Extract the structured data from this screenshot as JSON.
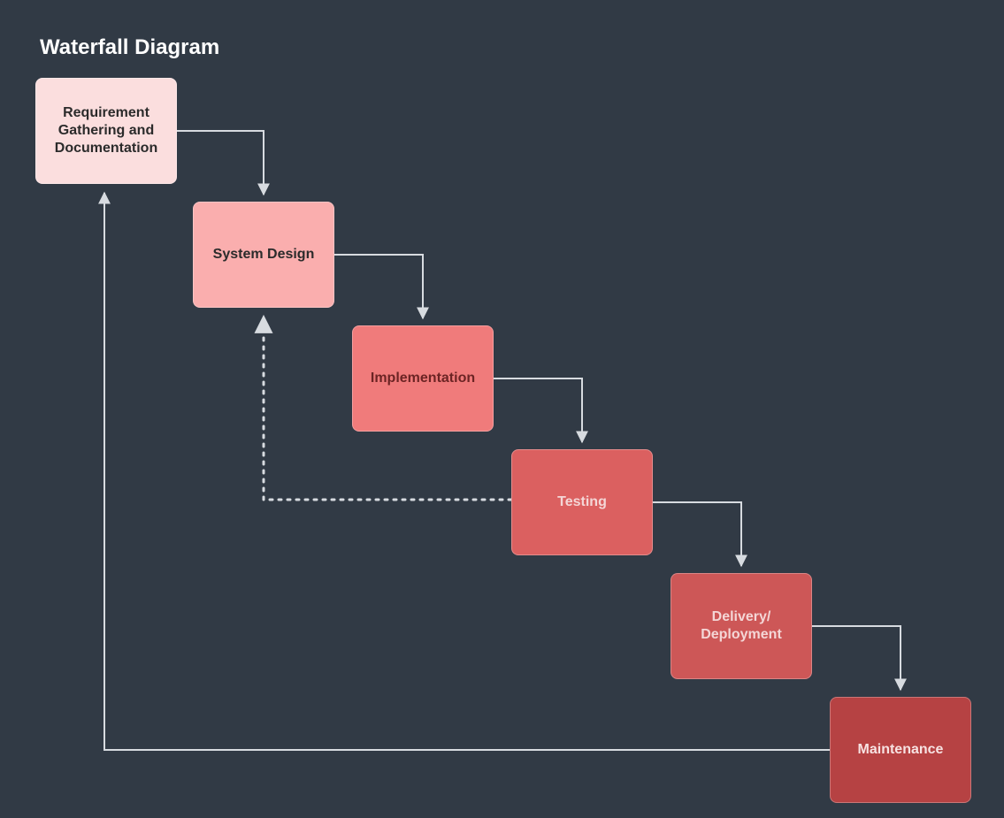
{
  "title": "Waterfall Diagram",
  "nodes": {
    "n1": "Requirement Gathering and Documentation",
    "n2": "System Design",
    "n3": "Implementation",
    "n4": "Testing",
    "n5": "Delivery/ Deployment",
    "n6": "Maintenance"
  },
  "colors": {
    "background": "#313a45",
    "line": "#d7dbe0",
    "dotted": "#d7dbe0",
    "nodes": [
      "#fbdede",
      "#faaeae",
      "#f07b7b",
      "#db6060",
      "#cd5757",
      "#b64243"
    ]
  },
  "chart_data": {
    "type": "table",
    "title": "Waterfall Diagram",
    "stages": [
      "Requirement Gathering and Documentation",
      "System Design",
      "Implementation",
      "Testing",
      "Delivery/Deployment",
      "Maintenance"
    ],
    "forward_edges": [
      [
        "Requirement Gathering and Documentation",
        "System Design"
      ],
      [
        "System Design",
        "Implementation"
      ],
      [
        "Implementation",
        "Testing"
      ],
      [
        "Testing",
        "Delivery/Deployment"
      ],
      [
        "Delivery/Deployment",
        "Maintenance"
      ]
    ],
    "feedback_edges": [
      {
        "from": "Testing",
        "to": "System Design",
        "style": "dotted"
      },
      {
        "from": "Maintenance",
        "to": "Requirement Gathering and Documentation",
        "style": "solid"
      }
    ]
  }
}
